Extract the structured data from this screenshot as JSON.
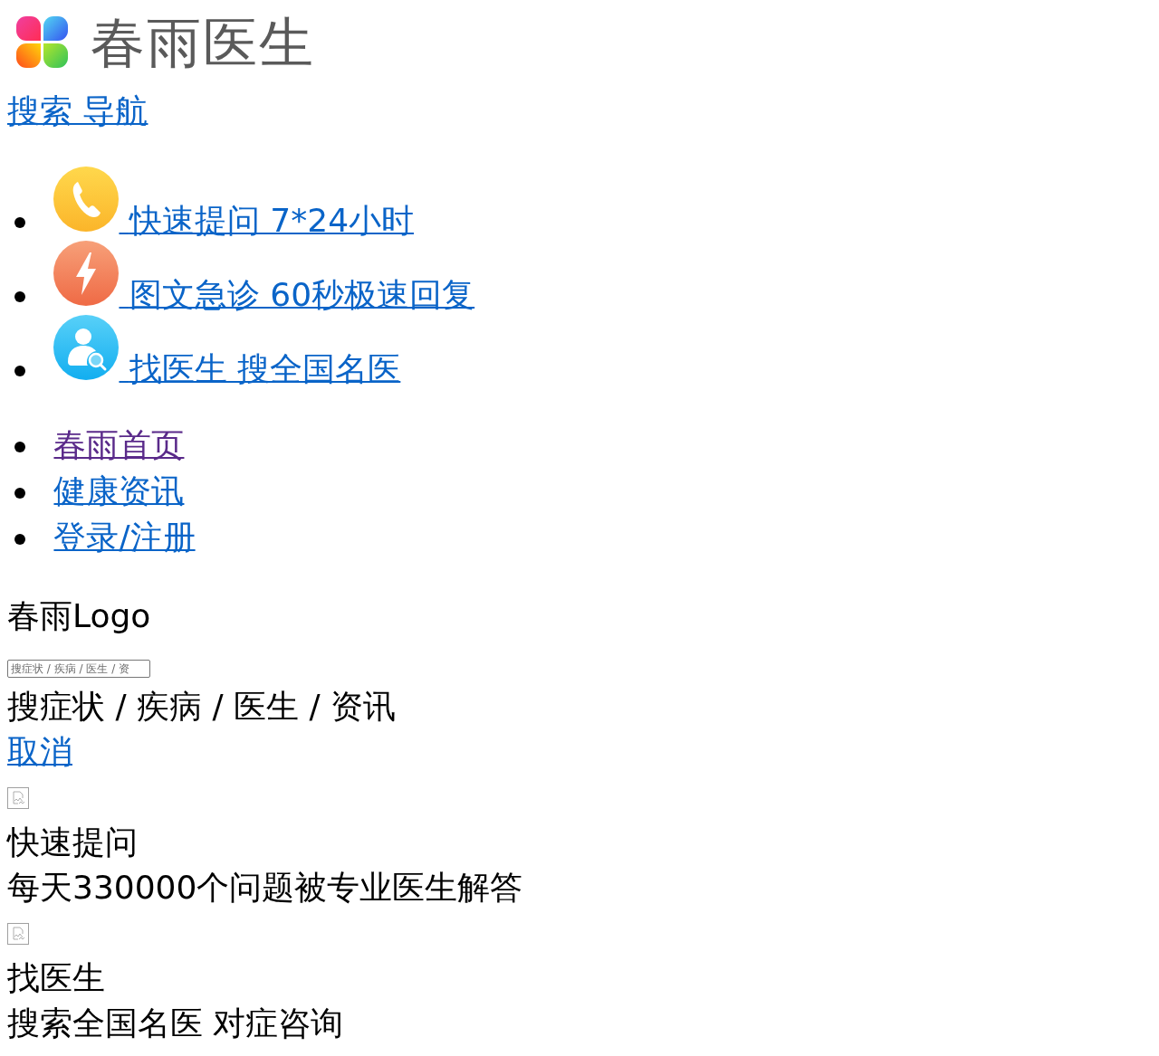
{
  "header": {
    "brand": "春雨医生",
    "nav_link": "搜索 导航"
  },
  "services": [
    {
      "kind": "phone",
      "label": "快速提问 7*24小时"
    },
    {
      "kind": "lightning",
      "label": "图文急诊 60秒极速回复"
    },
    {
      "kind": "doctor-search",
      "label": "找医生 搜全国名医"
    }
  ],
  "nav": [
    {
      "label": "春雨首页",
      "visited": true
    },
    {
      "label": "健康资讯",
      "visited": false
    },
    {
      "label": "登录/注册",
      "visited": false
    }
  ],
  "logo_alt": "春雨Logo",
  "search": {
    "placeholder": "搜症状 / 疾病 / 医生 / 资",
    "prompt": "搜症状 / 疾病 / 医生 / 资讯",
    "cancel": "取消"
  },
  "features": [
    {
      "title": "快速提问",
      "description": "每天330000个问题被专业医生解答"
    },
    {
      "title": "找医生",
      "description": "搜索全国名医 对症咨询"
    }
  ]
}
